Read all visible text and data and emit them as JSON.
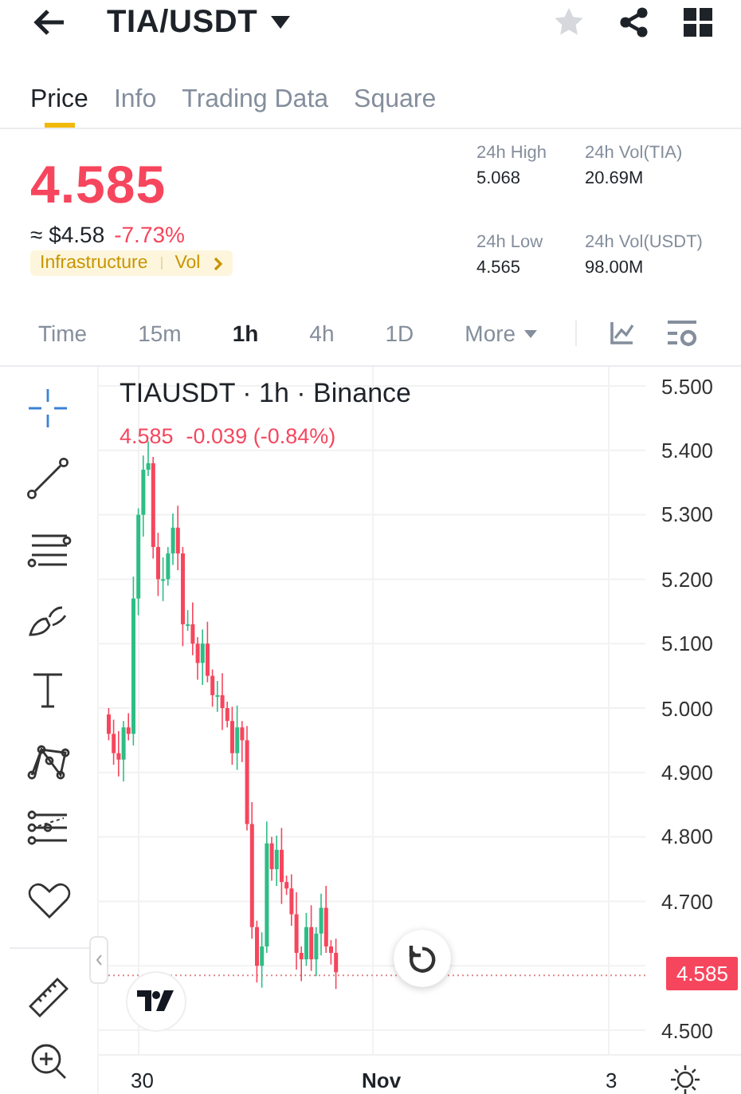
{
  "header": {
    "title": "TIA/USDT"
  },
  "tabs": [
    {
      "label": "Price",
      "selected": true
    },
    {
      "label": "Info",
      "selected": false
    },
    {
      "label": "Trading Data",
      "selected": false
    },
    {
      "label": "Square",
      "selected": false
    }
  ],
  "price": {
    "last": "4.585",
    "usd": "≈ $4.58",
    "change": "-7.73%",
    "tags": [
      "Infrastructure",
      "Vol"
    ]
  },
  "stats": [
    {
      "label": "24h High",
      "value": "5.068"
    },
    {
      "label": "24h Vol(TIA)",
      "value": "20.69M"
    },
    {
      "label": "24h Low",
      "value": "4.565"
    },
    {
      "label": "24h Vol(USDT)",
      "value": "98.00M"
    }
  ],
  "intervals": [
    {
      "label": "Time",
      "selected": false,
      "kind": "plain"
    },
    {
      "label": "15m",
      "selected": false,
      "kind": "plain"
    },
    {
      "label": "1h",
      "selected": true,
      "kind": "plain"
    },
    {
      "label": "4h",
      "selected": false,
      "kind": "plain"
    },
    {
      "label": "1D",
      "selected": false,
      "kind": "plain"
    },
    {
      "label": "More",
      "selected": false,
      "kind": "dropdown"
    }
  ],
  "chart": {
    "title": "TIAUSDT · 1h · Binance",
    "last": "4.585",
    "change": "-0.039 (-0.84%)",
    "y_labels": [
      "5.500",
      "5.400",
      "5.300",
      "5.200",
      "5.100",
      "5.000",
      "4.900",
      "4.800",
      "4.700",
      "4.500"
    ],
    "x_labels": [
      "30",
      "Nov",
      "3"
    ],
    "price_tag": "4.585"
  }
}
